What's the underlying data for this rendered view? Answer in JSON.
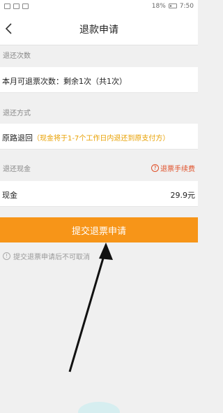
{
  "status": {
    "battery": "18%",
    "time": "7:50"
  },
  "nav": {
    "title": "退款申请"
  },
  "refund_count": {
    "label": "退还次数",
    "value": "本月可退票次数：剩余1次（共1次）"
  },
  "refund_method": {
    "label": "退还方式",
    "value": "原路退回",
    "hint": "（现金将于1-7个工作日内退还到原支付方）"
  },
  "refund_cash": {
    "label": "退还现金",
    "fee_link": "退票手续费",
    "item_label": "现金",
    "amount": "29.9元"
  },
  "submit": {
    "label": "提交退票申请"
  },
  "notice": {
    "text": "提交退票申请后不可取消"
  },
  "colors": {
    "accent": "#f79518",
    "hint": "#e8a000",
    "fee": "#e0512a"
  },
  "icons": [
    "back-icon",
    "question-icon",
    "info-icon"
  ]
}
